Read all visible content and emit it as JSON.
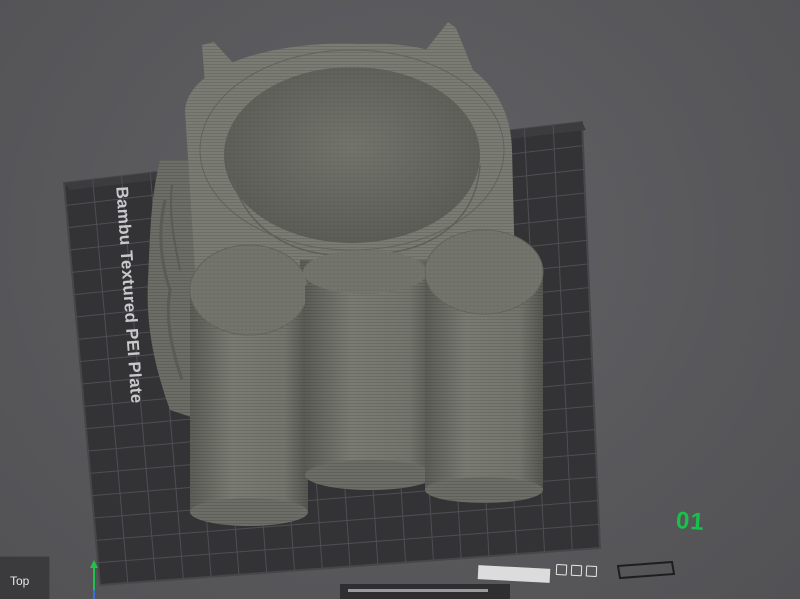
{
  "viewport": {
    "plate_label": "Bambu Textured PEI Plate",
    "plate_number": "01",
    "view_name": "Top"
  },
  "plate_toolbar": {
    "name_box_text": "",
    "icons": [
      "lock-icon",
      "frame-icon",
      "delete-icon"
    ]
  },
  "colors": {
    "background": "#5a5a5d",
    "plate": "#333336",
    "grid": "#4d4d52",
    "model": "#7b7c74",
    "plate_number": "#16c24a",
    "axis_y": "#22c24a",
    "axis_z": "#3a6fd8"
  }
}
